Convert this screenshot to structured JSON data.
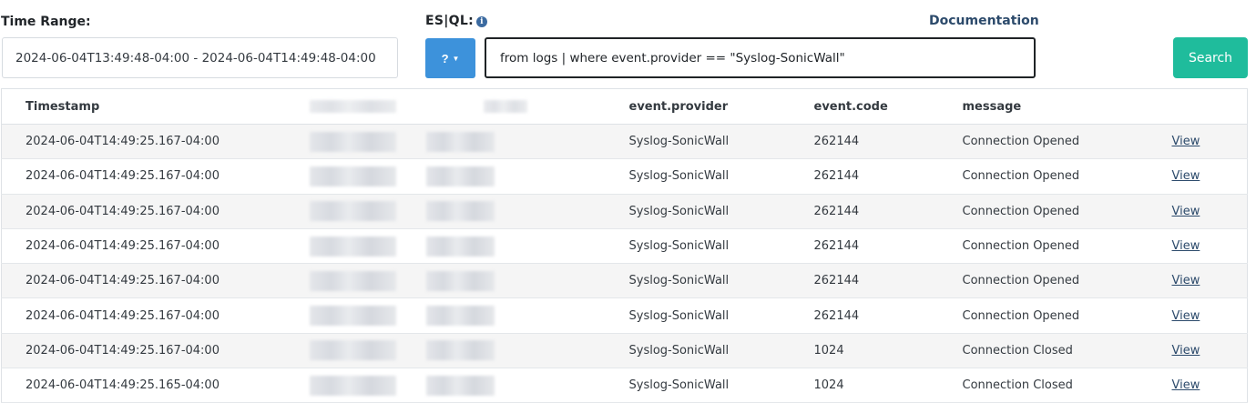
{
  "filters": {
    "time_range_label": "Time Range:",
    "time_range_value": "2024-06-04T13:49:48-04:00 - 2024-06-04T14:49:48-04:00",
    "esql_label": "ES|QL:",
    "help_button_label": "?",
    "query_value": "from logs | where event.provider == \"Syslog-SonicWall\"",
    "documentation_link": "Documentation",
    "search_button_label": "Search"
  },
  "table": {
    "columns": {
      "timestamp": "Timestamp",
      "provider": "event.provider",
      "code": "event.code",
      "message": "message"
    },
    "view_label": "View",
    "rows": [
      {
        "timestamp": "2024-06-04T14:49:25.167-04:00",
        "provider": "Syslog-SonicWall",
        "code": "262144",
        "message": "Connection Opened"
      },
      {
        "timestamp": "2024-06-04T14:49:25.167-04:00",
        "provider": "Syslog-SonicWall",
        "code": "262144",
        "message": "Connection Opened"
      },
      {
        "timestamp": "2024-06-04T14:49:25.167-04:00",
        "provider": "Syslog-SonicWall",
        "code": "262144",
        "message": "Connection Opened"
      },
      {
        "timestamp": "2024-06-04T14:49:25.167-04:00",
        "provider": "Syslog-SonicWall",
        "code": "262144",
        "message": "Connection Opened"
      },
      {
        "timestamp": "2024-06-04T14:49:25.167-04:00",
        "provider": "Syslog-SonicWall",
        "code": "262144",
        "message": "Connection Opened"
      },
      {
        "timestamp": "2024-06-04T14:49:25.167-04:00",
        "provider": "Syslog-SonicWall",
        "code": "262144",
        "message": "Connection Opened"
      },
      {
        "timestamp": "2024-06-04T14:49:25.167-04:00",
        "provider": "Syslog-SonicWall",
        "code": "1024",
        "message": "Connection Closed"
      },
      {
        "timestamp": "2024-06-04T14:49:25.165-04:00",
        "provider": "Syslog-SonicWall",
        "code": "1024",
        "message": "Connection Closed"
      }
    ]
  },
  "colors": {
    "help_button": "#3d92db",
    "search_button": "#1fbc9c",
    "link": "#2c4a6b"
  },
  "icons": {
    "info": "info-circle-icon",
    "caret": "caret-down-icon"
  }
}
